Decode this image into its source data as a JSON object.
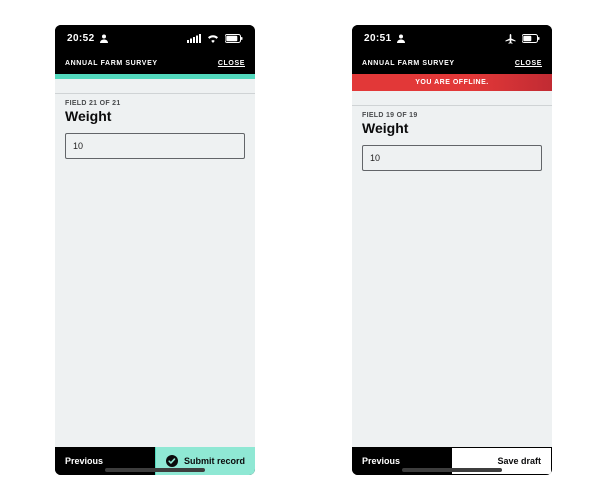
{
  "phone_online": {
    "status": {
      "time": "20:52",
      "profile_icon": "person-icon"
    },
    "header": {
      "title": "ANNUAL FARM SURVEY",
      "close": "CLOSE"
    },
    "form": {
      "field_count": "FIELD 21 OF 21",
      "field_title": "Weight",
      "value": "10"
    },
    "footer": {
      "previous": "Previous",
      "submit": "Submit record"
    }
  },
  "phone_offline": {
    "status": {
      "time": "20:51",
      "profile_icon": "person-icon"
    },
    "header": {
      "title": "ANNUAL FARM SURVEY",
      "close": "CLOSE"
    },
    "banner": "YOU ARE OFFLINE.",
    "form": {
      "field_count": "FIELD 19 OF 19",
      "field_title": "Weight",
      "value": "10"
    },
    "footer": {
      "previous": "Previous",
      "draft": "Save draft"
    }
  },
  "colors": {
    "accent_online": "#52d9bd",
    "accent_offline": "#e23838",
    "background": "#eef1f2"
  }
}
